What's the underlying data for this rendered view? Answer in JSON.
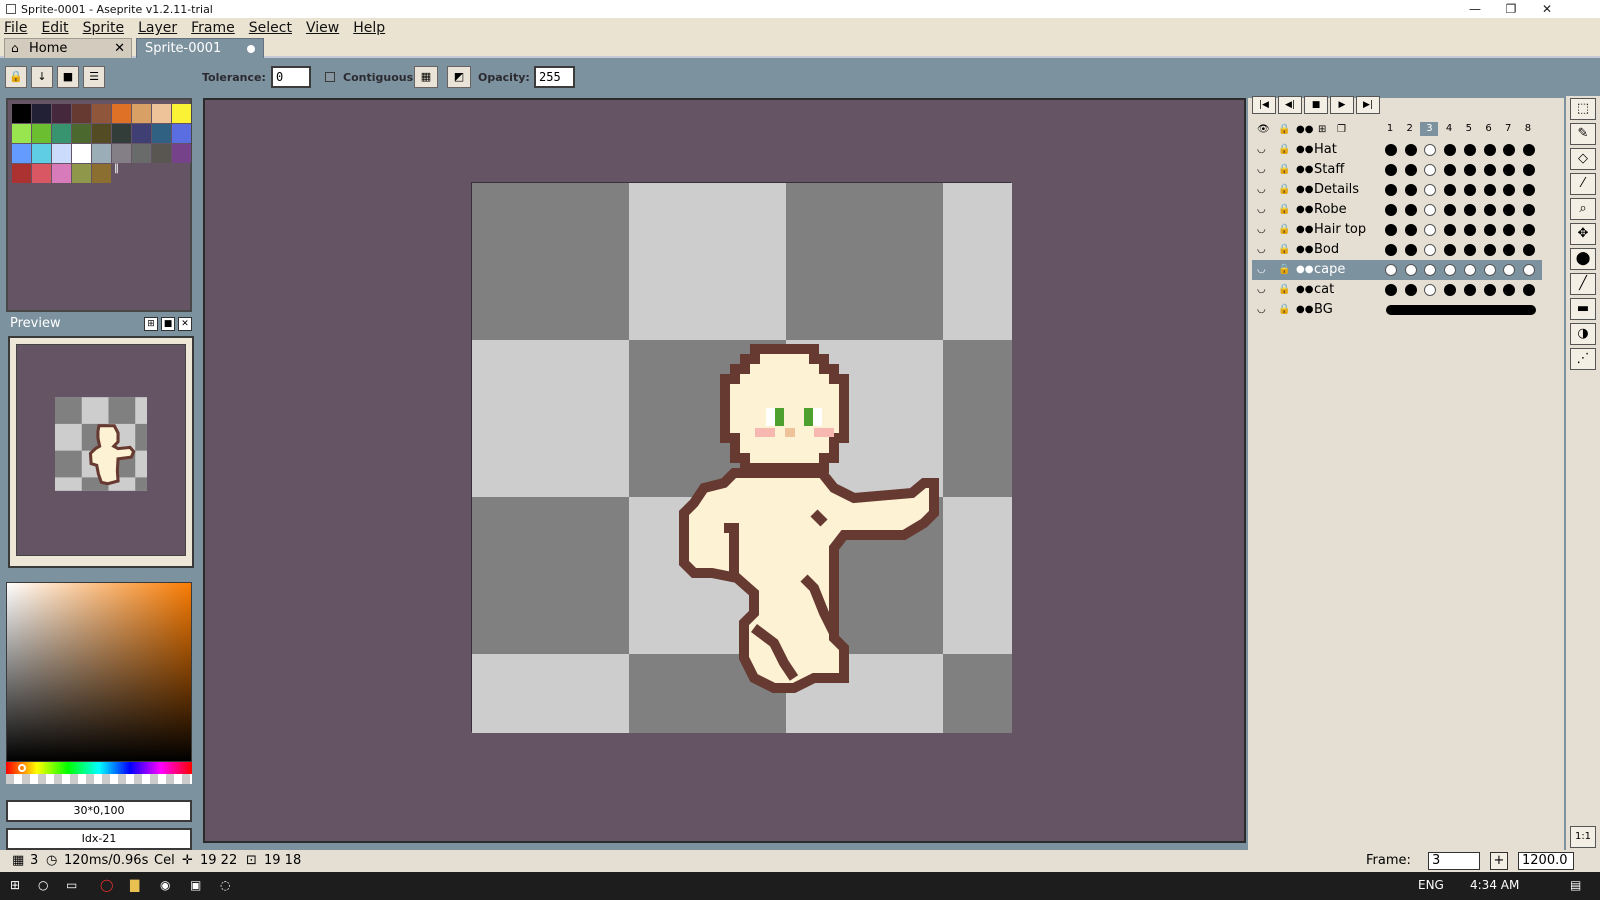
{
  "window": {
    "title": "Sprite-0001 - Aseprite v1.2.11-trial",
    "minimize": "—",
    "maximize": "❐",
    "close": "✕"
  },
  "menu": [
    "File",
    "Edit",
    "Sprite",
    "Layer",
    "Frame",
    "Select",
    "View",
    "Help"
  ],
  "tabs": [
    {
      "label": "Home",
      "icon": "home-icon",
      "close": "✕"
    },
    {
      "label": "Sprite-0001",
      "modified_dot": true
    }
  ],
  "toolbar": {
    "tolerance_label": "Tolerance:",
    "tolerance_value": "0",
    "contiguous_label": "Contiguous",
    "opacity_label": "Opacity:",
    "opacity_value": "255",
    "buttons": [
      "lock-icon",
      "arrow-down-icon",
      "stop-icon",
      "menu-icon"
    ]
  },
  "palette": {
    "colors": [
      "#000000",
      "#222034",
      "#45283c",
      "#663931",
      "#8f563b",
      "#df7126",
      "#d9a066",
      "#eec39a",
      "#fbf236",
      "#99e550",
      "#6abe30",
      "#37946e",
      "#4b692f",
      "#524b24",
      "#323c39",
      "#3f3f74",
      "#306082",
      "#5b6ee1",
      "#639bff",
      "#5fcde4",
      "#cbdbfc",
      "#ffffff",
      "#9badb7",
      "#847e87",
      "#696a6a",
      "#595652",
      "#76428a",
      "#ac3232",
      "#d95763",
      "#d77bba",
      "#8f974a",
      "#8a6f30"
    ]
  },
  "preview": {
    "title": "Preview"
  },
  "color_fields": {
    "color_value": "30*0,100",
    "index_value": "Idx-21"
  },
  "animation_controls": [
    "first-frame-icon",
    "prev-frame-icon",
    "stop-icon",
    "play-icon",
    "last-frame-icon"
  ],
  "timeline": {
    "frames": [
      "1",
      "2",
      "3",
      "4",
      "5",
      "6",
      "7",
      "8"
    ],
    "current_frame": 3,
    "layers": [
      {
        "name": "Hat",
        "selected": false,
        "bg": false
      },
      {
        "name": "Staff",
        "selected": false,
        "bg": false
      },
      {
        "name": "Details",
        "selected": false,
        "bg": false
      },
      {
        "name": "Robe",
        "selected": false,
        "bg": false
      },
      {
        "name": "Hair top",
        "selected": false,
        "bg": false
      },
      {
        "name": "Bod",
        "selected": false,
        "bg": false
      },
      {
        "name": "cape",
        "selected": true,
        "bg": false
      },
      {
        "name": "cat",
        "selected": false,
        "bg": false
      },
      {
        "name": "BG",
        "selected": false,
        "bg": true
      }
    ]
  },
  "status": {
    "frame_number": "3",
    "duration": "120ms/0.96s",
    "cel_label": "Cel",
    "cursor_pos": "19 22",
    "selection_size": "19 18",
    "frame_label": "Frame:",
    "frame_value": "3",
    "zoom_value": "1200.0"
  },
  "right_tools": [
    "marquee-icon",
    "pencil-icon",
    "eraser-icon",
    "eyedropper-icon",
    "zoom-icon",
    "move-icon",
    "paint-bucket-icon",
    "line-icon",
    "rectangle-icon",
    "blur-icon",
    "spray-icon"
  ],
  "taskbar": {
    "time": "4:34 AM",
    "lang": "ENG"
  },
  "colors": {
    "canvas_bg": "#645464",
    "panel_bg": "#e4dfd2",
    "accent": "#7d929f",
    "outline": "#663931",
    "skin": "#fef2d4"
  }
}
